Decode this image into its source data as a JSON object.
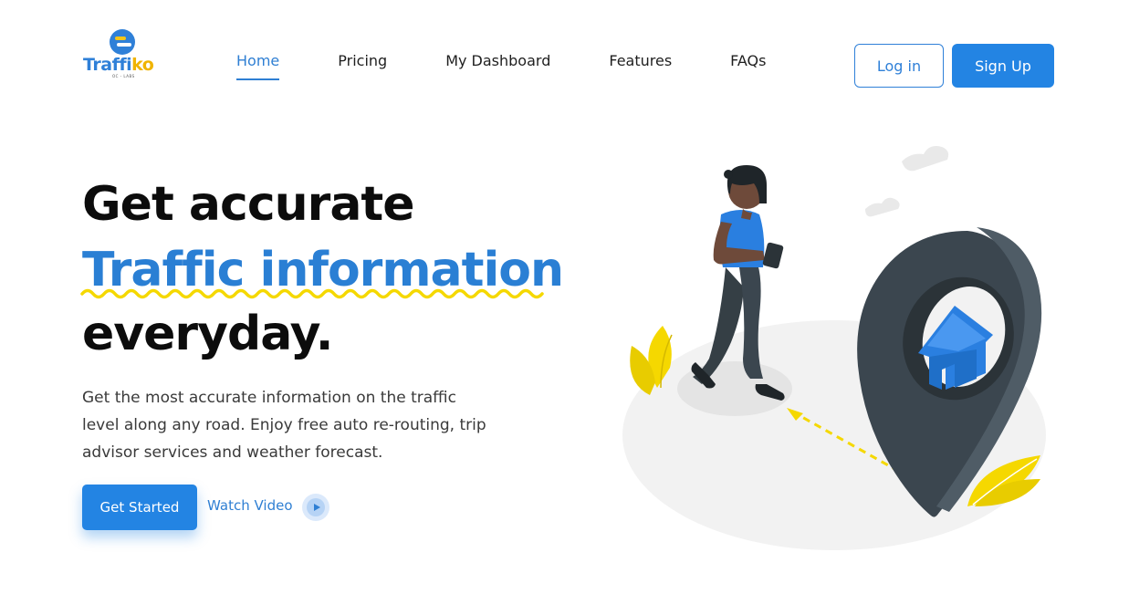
{
  "brand": {
    "name_part1": "Traffi",
    "name_part2": "ko",
    "sub": "OC - LABS"
  },
  "nav": {
    "items": [
      {
        "label": "Home",
        "active": true
      },
      {
        "label": "Pricing"
      },
      {
        "label": "My Dashboard"
      },
      {
        "label": "Features"
      },
      {
        "label": "FAQs"
      }
    ]
  },
  "auth": {
    "login_label": "Log in",
    "signup_label": "Sign Up"
  },
  "hero": {
    "line1": "Get accurate",
    "line2": "Traffic information",
    "line3": "everyday.",
    "desc_lines": [
      "Get the most accurate information on the traffic",
      "level along any road. Enjoy free auto re-routing, trip",
      "advisor services and weather forecast."
    ],
    "cta_label": "Get Started",
    "video_label": "Watch Video"
  },
  "colors": {
    "accent": "#2384e3",
    "brand_blue": "#2f80d8",
    "highlight_yellow": "#f5d800",
    "pin_dark": "#3b464f"
  },
  "icons": [
    "logo-icon",
    "play-icon",
    "location-pin-icon",
    "house-icon",
    "cloud-icon",
    "leaf-icon"
  ]
}
